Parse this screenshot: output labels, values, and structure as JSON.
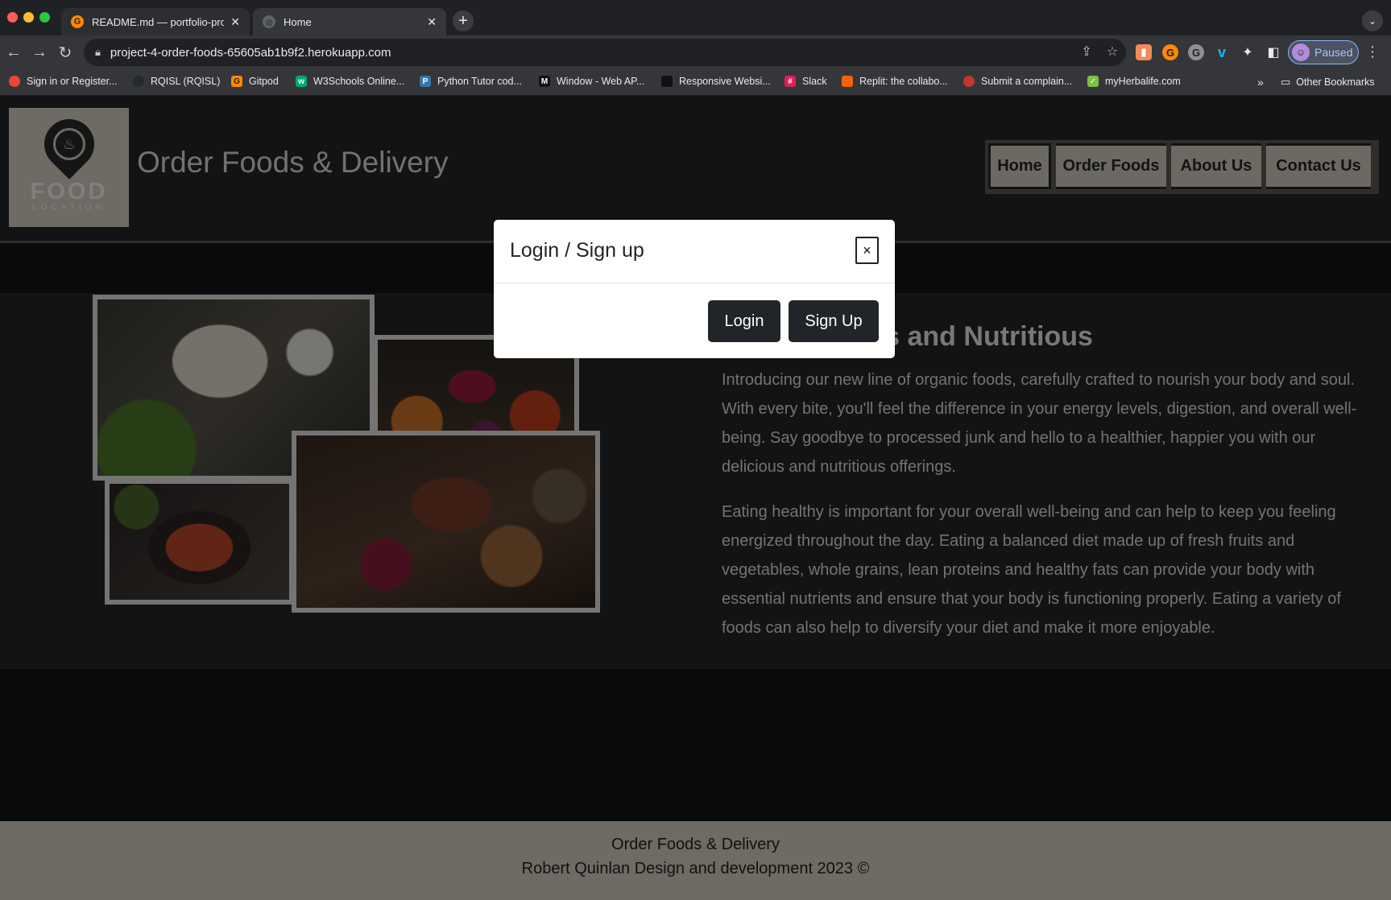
{
  "browser": {
    "tabs": [
      {
        "title": "README.md — portfolio-proje",
        "favicon": "gitpod-icon"
      },
      {
        "title": "Home",
        "favicon": "globe-icon"
      }
    ],
    "url": "project-4-order-foods-65605ab1b9f2.herokuapp.com",
    "profile_status": "Paused",
    "bookmarks": [
      {
        "label": "Sign in or Register...",
        "color": "#e8473a"
      },
      {
        "label": "RQISL (RQISL)",
        "color": "#24292e"
      },
      {
        "label": "Gitpod",
        "color": "#ff8a00"
      },
      {
        "label": "W3Schools Online...",
        "color": "#04aa6d"
      },
      {
        "label": "Python Tutor cod...",
        "color": "#3776ab"
      },
      {
        "label": "Window - Web AP...",
        "color": "#111111"
      },
      {
        "label": "Responsive Websi...",
        "color": "#111111"
      },
      {
        "label": "Slack",
        "color": "#e01e5a"
      },
      {
        "label": "Replit: the collabo...",
        "color": "#f26207"
      },
      {
        "label": "Submit a complain...",
        "color": "#c0392b"
      },
      {
        "label": "myHerbalife.com",
        "color": "#7ac143"
      }
    ],
    "other_bookmarks": "Other Bookmarks"
  },
  "header": {
    "logo_word": "FOOD",
    "logo_sub": "LOCATION",
    "site_title": "Order Foods & Delivery",
    "nav": [
      "Home",
      "Order Foods",
      "About Us",
      "Contact Us"
    ]
  },
  "content": {
    "heading": "Our Delicious and Nutritious",
    "paragraphs": [
      "Introducing our new line of organic foods, carefully crafted to nourish your body and soul. With every bite, you'll feel the difference in your energy levels, digestion, and overall well-being. Say goodbye to processed junk and hello to a healthier, happier you with our delicious and nutritious offerings.",
      "Eating healthy is important for your overall well-being and can help to keep you feeling energized throughout the day. Eating a balanced diet made up of fresh fruits and vegetables, whole grains, lean proteins and healthy fats can provide your body with essential nutrients and ensure that your body is functioning properly. Eating a variety of foods can also help to diversify your diet and make it more enjoyable."
    ]
  },
  "footer": {
    "line1": "Order Foods & Delivery",
    "line2": "Robert Quinlan Design and development 2023 ©"
  },
  "modal": {
    "title": "Login / Sign up",
    "close": "×",
    "login": "Login",
    "signup": "Sign Up"
  }
}
